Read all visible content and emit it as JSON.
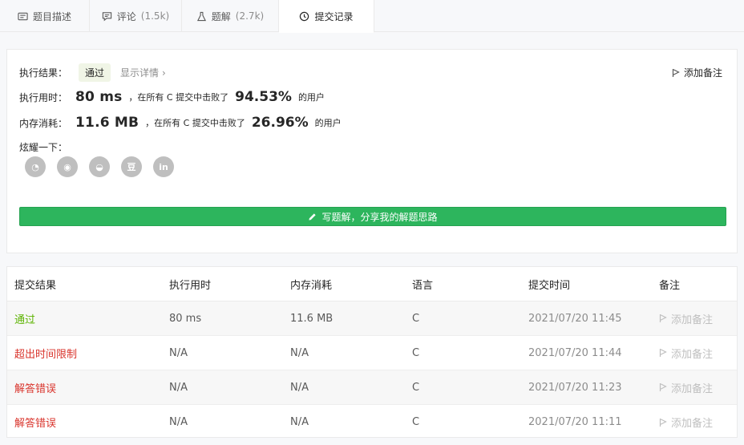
{
  "tabs": [
    {
      "label": "题目描述",
      "count": "",
      "icon": "description-icon"
    },
    {
      "label": "评论",
      "count": "(1.5k)",
      "icon": "comment-icon"
    },
    {
      "label": "题解",
      "count": "(2.7k)",
      "icon": "flask-icon"
    },
    {
      "label": "提交记录",
      "count": "",
      "icon": "clock-icon"
    }
  ],
  "result": {
    "status_label": "执行结果：",
    "status_value": "通过",
    "detail_link": "显示详情",
    "add_note": "添加备注",
    "runtime_label": "执行用时：",
    "runtime_value": "80 ms",
    "runtime_text1": "，在所有 C 提交中击败了",
    "runtime_pct": "94.53%",
    "runtime_text2": "的用户",
    "memory_label": "内存消耗：",
    "memory_value": "11.6 MB",
    "memory_text1": "，在所有 C 提交中击败了",
    "memory_pct": "26.96%",
    "memory_text2": "的用户",
    "share_label": "炫耀一下：",
    "share_icons": [
      "wechat-icon",
      "weibo-icon",
      "qq-icon",
      "douban-icon",
      "linkedin-icon"
    ],
    "share_glyphs": [
      "◔",
      "◉",
      "◒",
      "豆",
      "in"
    ],
    "write_button": "写题解，分享我的解题思路"
  },
  "table": {
    "headers": [
      "提交结果",
      "执行用时",
      "内存消耗",
      "语言",
      "提交时间",
      "备注"
    ],
    "rows": [
      {
        "status": "通过",
        "runtime": "80 ms",
        "memory": "11.6 MB",
        "lang": "C",
        "time": "2021/07/20 11:45",
        "note": "添加备注"
      },
      {
        "status": "超出时间限制",
        "runtime": "N/A",
        "memory": "N/A",
        "lang": "C",
        "time": "2021/07/20 11:44",
        "note": "添加备注"
      },
      {
        "status": "解答错误",
        "runtime": "N/A",
        "memory": "N/A",
        "lang": "C",
        "time": "2021/07/20 11:23",
        "note": "添加备注"
      },
      {
        "status": "解答错误",
        "runtime": "N/A",
        "memory": "N/A",
        "lang": "C",
        "time": "2021/07/20 11:11",
        "note": "添加备注"
      }
    ]
  },
  "colors": {
    "accent_green": "#2db55d",
    "pass_green": "#5cb300",
    "error_red": "#d9342c"
  }
}
